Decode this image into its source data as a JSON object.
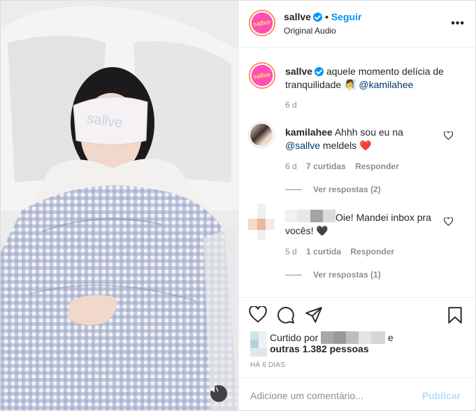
{
  "post": {
    "media_alt_brand": "sallve"
  },
  "header": {
    "username": "sallve",
    "dot": "•",
    "follow_label": "Seguir",
    "audio_label": "Original Audio",
    "avatar_logo": "sallve"
  },
  "caption": {
    "username": "sallve",
    "text": "aquele momento delícia de tranquilidade 🧖‍♀️",
    "mention": "@kamilahee",
    "age": "6 d"
  },
  "comments": [
    {
      "username": "kamilahee",
      "text": "Ahhh sou eu na",
      "mention": "@sallve",
      "text2": "meldels",
      "emoji": "❤️",
      "age": "6 d",
      "likes": "7 curtidas",
      "reply": "Responder",
      "view_replies": "Ver respostas (2)"
    },
    {
      "text": "Oie! Mandei inbox pra vocês! 🖤",
      "age": "5 d",
      "likes": "1 curtida",
      "reply": "Responder",
      "view_replies": "Ver respostas (1)"
    }
  ],
  "likes": {
    "prefix": "Curtido por",
    "suffix": "e",
    "others": "outras 1.382 pessoas"
  },
  "timestamp": "HÁ 6 DIAS",
  "add_comment": {
    "placeholder": "Adicione um comentário...",
    "publish": "Publicar"
  },
  "colors": {
    "accent": "#0095f6",
    "publish_disabled": "#b2dffc",
    "secondary_text": "#8e8e8e",
    "heart_red": "#ed1c24"
  },
  "icons": [
    "verified-icon",
    "more-icon",
    "heart-icon",
    "comment-icon",
    "share-icon",
    "save-icon",
    "mute-icon"
  ]
}
